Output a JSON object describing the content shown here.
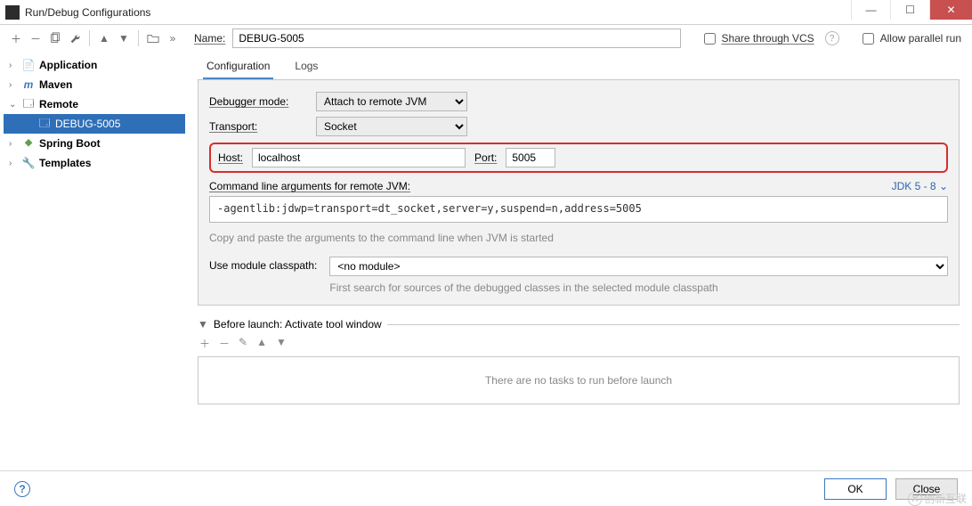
{
  "window": {
    "title": "Run/Debug Configurations"
  },
  "topbar": {
    "name_label": "Name:",
    "name_value": "DEBUG-5005",
    "share_label": "Share through VCS",
    "parallel_label": "Allow parallel run"
  },
  "tree": {
    "items": [
      {
        "label": "Application",
        "bold": true
      },
      {
        "label": "Maven",
        "bold": true
      },
      {
        "label": "Remote",
        "bold": true,
        "expanded": true
      },
      {
        "label": "DEBUG-5005",
        "bold": false,
        "child": true,
        "selected": true
      },
      {
        "label": "Spring Boot",
        "bold": true
      },
      {
        "label": "Templates",
        "bold": true
      }
    ]
  },
  "tabs": {
    "configuration": "Configuration",
    "logs": "Logs"
  },
  "form": {
    "debugger_mode_label": "Debugger mode:",
    "debugger_mode_value": "Attach to remote JVM",
    "transport_label": "Transport:",
    "transport_value": "Socket",
    "host_label": "Host:",
    "host_value": "localhost",
    "port_label": "Port:",
    "port_value": "5005",
    "cmd_label": "Command line arguments for remote JVM:",
    "jdk_label": "JDK 5 - 8",
    "cmd_value": "-agentlib:jdwp=transport=dt_socket,server=y,suspend=n,address=5005",
    "copy_hint": "Copy and paste the arguments to the command line when JVM is started",
    "module_label": "Use module classpath:",
    "module_value": "<no module>",
    "module_hint": "First search for sources of the debugged classes in the selected module classpath"
  },
  "before_launch": {
    "title": "Before launch: Activate tool window",
    "empty": "There are no tasks to run before launch"
  },
  "footer": {
    "ok": "OK",
    "close": "Close"
  },
  "watermark": "创新互联"
}
